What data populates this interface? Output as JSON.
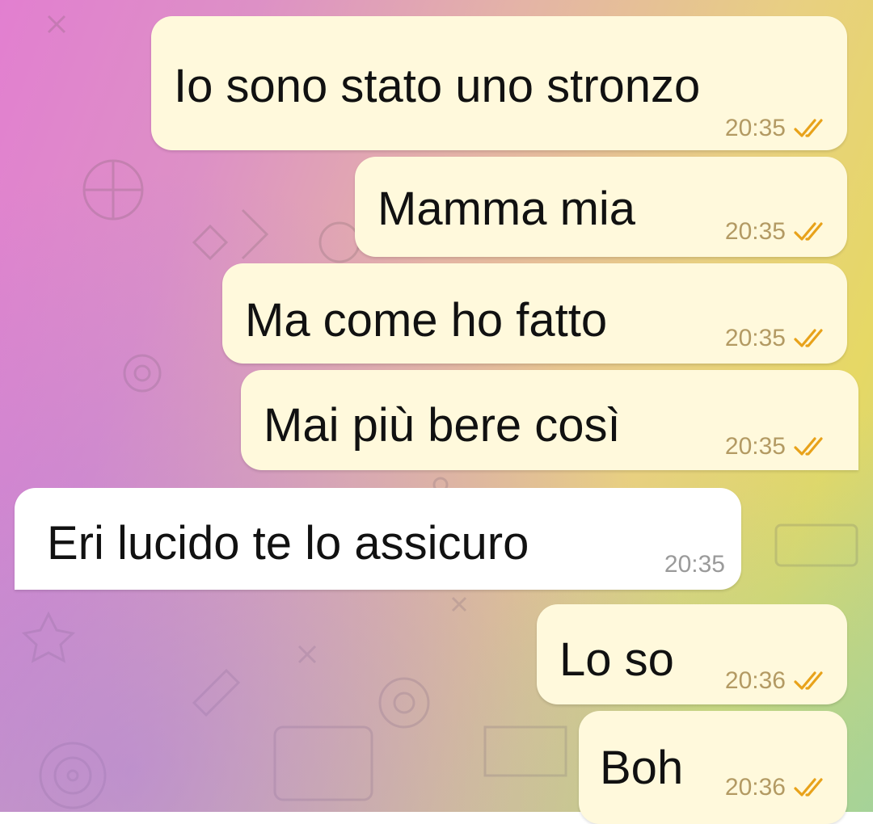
{
  "chat": {
    "messages": [
      {
        "direction": "out",
        "text": "Io sono stato uno stronzo",
        "time": "20:35",
        "status_icon": "double-check-icon"
      },
      {
        "direction": "out",
        "text": "Mamma mia",
        "time": "20:35",
        "status_icon": "double-check-icon"
      },
      {
        "direction": "out",
        "text": "Ma come ho fatto",
        "time": "20:35",
        "status_icon": "double-check-icon"
      },
      {
        "direction": "out",
        "text": "Mai più bere così",
        "time": "20:35",
        "status_icon": "double-check-icon"
      },
      {
        "direction": "in",
        "text": "Eri lucido te lo assicuro",
        "time": "20:35"
      },
      {
        "direction": "out",
        "text": "Lo so",
        "time": "20:36",
        "status_icon": "double-check-icon"
      },
      {
        "direction": "out",
        "text": "Boh",
        "time": "20:36",
        "status_icon": "double-check-icon"
      }
    ]
  },
  "colors": {
    "outgoing_bubble": "#fff9dc",
    "incoming_bubble": "#ffffff",
    "check_color": "#e8a21a",
    "time_out": "#b39a63",
    "time_in": "#9a9a9a"
  }
}
